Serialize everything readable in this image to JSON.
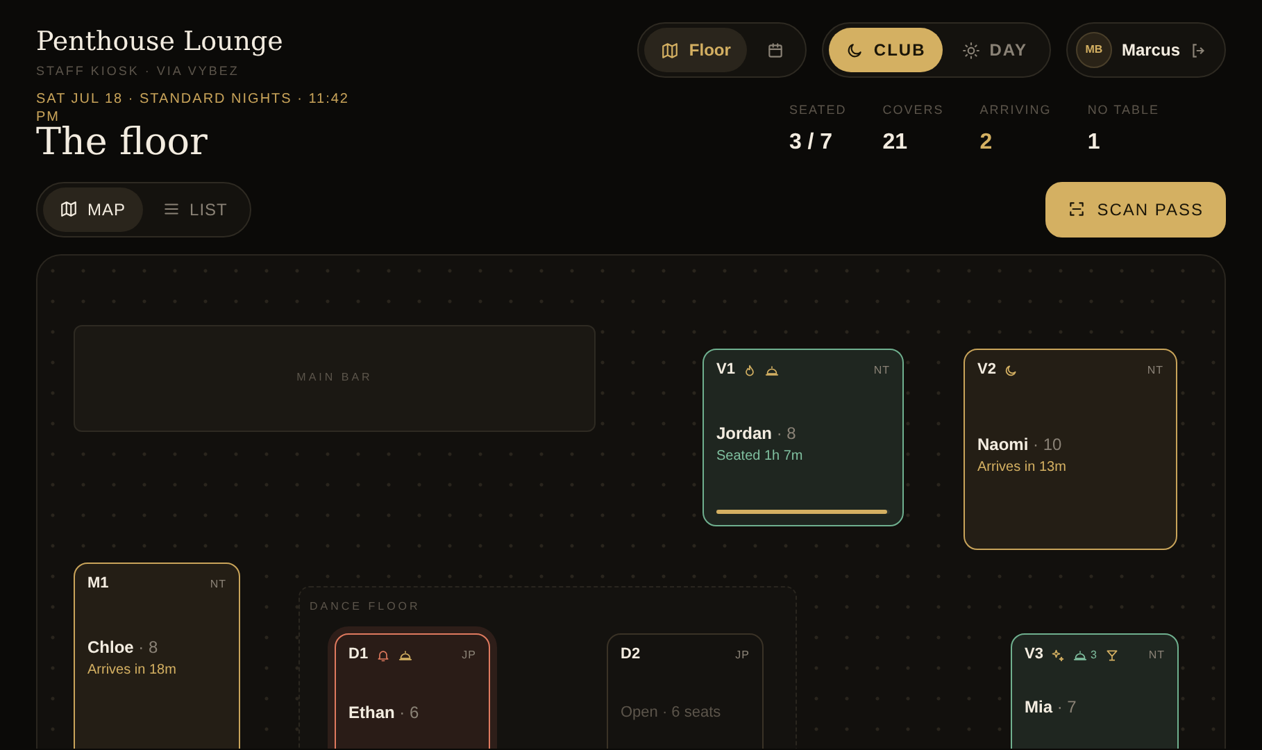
{
  "header": {
    "title": "Penthouse Lounge",
    "subtitle": "STAFF KIOSK · VIA VYBEZ"
  },
  "nav_tabs": [
    {
      "kind": "map",
      "label": "Floor",
      "selected": true
    },
    {
      "kind": "calendar",
      "selected": false
    }
  ],
  "mode_tabs": [
    {
      "kind": "moon",
      "label": "CLUB",
      "selected": true
    },
    {
      "kind": "sun",
      "label": "DAY",
      "selected": false
    }
  ],
  "user": {
    "initials": "MB",
    "name": "Marcus"
  },
  "date_line": "SAT JUL 18 · STANDARD NIGHTS · 11:42 PM",
  "page_title": "The floor",
  "stats": [
    {
      "label": "SEATED",
      "value": "3 / 7",
      "color": "#f3ece0"
    },
    {
      "label": "COVERS",
      "value": "21",
      "color": "#f3ece0"
    },
    {
      "label": "ARRIVING",
      "value": "2",
      "color": "#d4b062"
    },
    {
      "label": "NO TABLE",
      "value": "1",
      "color": "#f3ece0"
    }
  ],
  "view_tabs": [
    {
      "kind": "map",
      "label": "MAP",
      "selected": true
    },
    {
      "kind": "list",
      "label": "LIST",
      "selected": false
    }
  ],
  "scan_button": "SCAN PASS",
  "floor": {
    "zones": [
      {
        "kind": "bar",
        "label": "MAIN BAR"
      },
      {
        "kind": "dance",
        "label": "DANCE FLOOR"
      }
    ],
    "tables": [
      {
        "id": "V1",
        "kind": "seated",
        "server": "NT",
        "guest": "Jordan",
        "party": "· 8",
        "note": "Seated 1h 7m",
        "level": 0.98,
        "icons": [
          {
            "kind": "flame",
            "color": "#d4b062"
          },
          {
            "kind": "cloche",
            "color": "#d4b062"
          }
        ]
      },
      {
        "id": "V2",
        "kind": "arriving",
        "server": "NT",
        "guest": "Naomi",
        "party": "· 10",
        "note": "Arrives in 13m",
        "icons": [
          {
            "kind": "moon",
            "color": "#d4b062"
          }
        ]
      },
      {
        "id": "M1",
        "kind": "arriving",
        "server": "NT",
        "guest": "Chloe",
        "party": "· 8",
        "note": "Arrives in 18m"
      },
      {
        "id": "D1",
        "kind": "alert",
        "server": "JP",
        "guest": "Ethan",
        "party": "· 6",
        "icons": [
          {
            "kind": "bell",
            "color": "#e07a5f"
          },
          {
            "kind": "cloche",
            "color": "#d4b062"
          }
        ]
      },
      {
        "id": "D2",
        "kind": "open",
        "server": "JP",
        "note": "Open · 6 seats"
      },
      {
        "id": "V3",
        "kind": "seated",
        "server": "NT",
        "guest": "Mia",
        "party": "· 7",
        "icons": [
          {
            "kind": "sparkle",
            "color": "#d4b062"
          },
          {
            "kind": "cloche",
            "color": "#7fbf9f",
            "count": "3"
          },
          {
            "kind": "cocktail",
            "color": "#d4b062"
          }
        ]
      }
    ]
  }
}
